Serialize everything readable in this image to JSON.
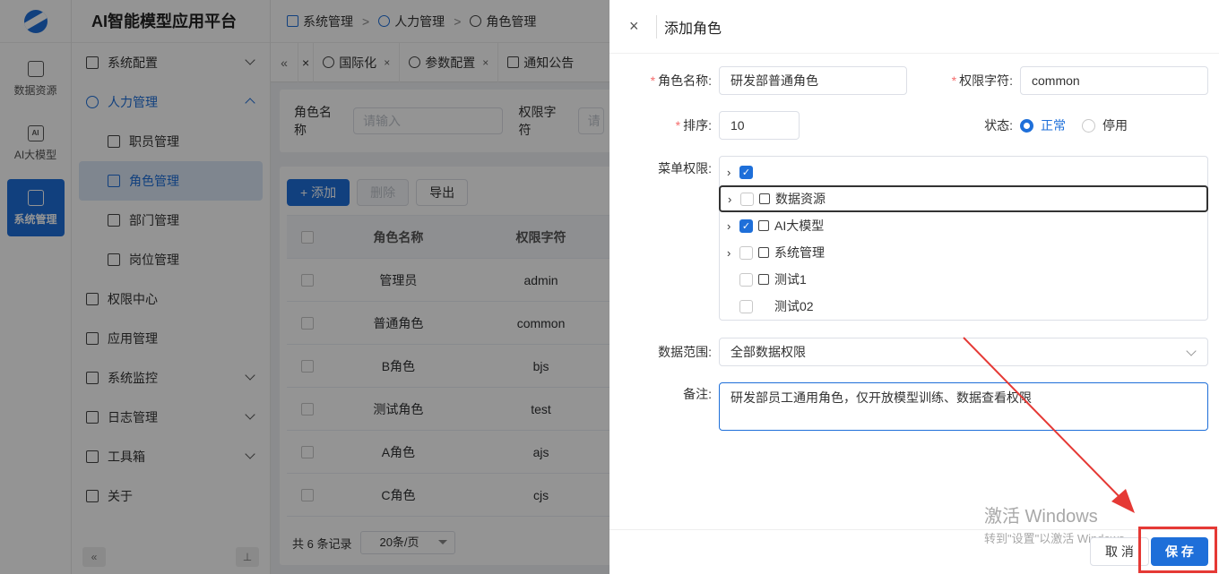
{
  "rail": {
    "items": [
      {
        "label": "数据资源",
        "icon": "data-resource-icon"
      },
      {
        "label": "AI大模型",
        "icon": "ai-model-icon"
      },
      {
        "label": "系统管理",
        "icon": "system-manage-icon"
      }
    ],
    "active_index": 2
  },
  "side": {
    "brand": "AI智能模型应用平台",
    "menu": [
      {
        "label": "系统配置",
        "icon": "grid-icon",
        "expandable": true
      },
      {
        "label": "人力管理",
        "icon": "user-icon",
        "expandable": true,
        "open": true
      },
      {
        "label": "职员管理",
        "icon": "staff-icon",
        "sub": true
      },
      {
        "label": "角色管理",
        "icon": "role-icon",
        "sub": true,
        "active": true
      },
      {
        "label": "部门管理",
        "icon": "dept-icon",
        "sub": true
      },
      {
        "label": "岗位管理",
        "icon": "post-icon",
        "sub": true
      },
      {
        "label": "权限中心",
        "icon": "lock-icon"
      },
      {
        "label": "应用管理",
        "icon": "app-icon"
      },
      {
        "label": "系统监控",
        "icon": "monitor-icon",
        "expandable": true
      },
      {
        "label": "日志管理",
        "icon": "log-icon",
        "expandable": true
      },
      {
        "label": "工具箱",
        "icon": "tools-icon",
        "expandable": true
      },
      {
        "label": "关于",
        "icon": "about-icon"
      }
    ],
    "collapse_glyph": "«",
    "pin_glyph": "⊥"
  },
  "breadcrumb": [
    "系统管理",
    "人力管理",
    "角色管理"
  ],
  "tabs": {
    "nav_glyph": "«",
    "close_glyph": "×",
    "items": [
      "国际化",
      "参数配置",
      "通知公告"
    ]
  },
  "search": {
    "role_name_label": "角色名称",
    "role_name_placeholder": "请输入",
    "perm_label": "权限字符",
    "perm_placeholder": "请"
  },
  "toolbar": {
    "add": "+ 添加",
    "delete": "删除",
    "export": "导出"
  },
  "table": {
    "headers": [
      "角色名称",
      "权限字符"
    ],
    "rows": [
      [
        "管理员",
        "admin"
      ],
      [
        "普通角色",
        "common"
      ],
      [
        "B角色",
        "bjs"
      ],
      [
        "测试角色",
        "test"
      ],
      [
        "A角色",
        "ajs"
      ],
      [
        "C角色",
        "cjs"
      ]
    ]
  },
  "pager": {
    "total": "共 6 条记录",
    "size": "20条/页"
  },
  "drawer": {
    "close_glyph": "×",
    "title": "添加角色",
    "role_name_label": "角色名称:",
    "role_name_value": "研发部普通角色",
    "perm_label": "权限字符:",
    "perm_value": "common",
    "sort_label": "排序:",
    "sort_value": "10",
    "status_label": "状态:",
    "status_on": "正常",
    "status_off": "停用",
    "menu_perm_label": "菜单权限:",
    "tree": [
      {
        "label": "",
        "checked": true,
        "arrow": true,
        "icon": ""
      },
      {
        "label": "数据资源",
        "checked": false,
        "arrow": true,
        "icon": "data-resource-icon",
        "highlight": true
      },
      {
        "label": "AI大模型",
        "checked": true,
        "arrow": true,
        "icon": "ai-model-icon"
      },
      {
        "label": "系统管理",
        "checked": false,
        "arrow": true,
        "icon": "system-manage-icon"
      },
      {
        "label": "测试1",
        "checked": false,
        "arrow": false,
        "icon": "file-icon"
      },
      {
        "label": "测试02",
        "checked": false,
        "arrow": false,
        "icon": ""
      }
    ],
    "scope_label": "数据范围:",
    "scope_value": "全部数据权限",
    "remark_label": "备注:",
    "remark_value": "研发部员工通用角色，仅开放模型训练、数据查看权限",
    "cancel": "取 消",
    "save": "保 存"
  },
  "watermark": {
    "line1": "激活 Windows",
    "line2": "转到\"设置\"以激活 Windows。"
  },
  "colors": {
    "primary": "#1e6fd9",
    "annotation": "#e53935"
  }
}
